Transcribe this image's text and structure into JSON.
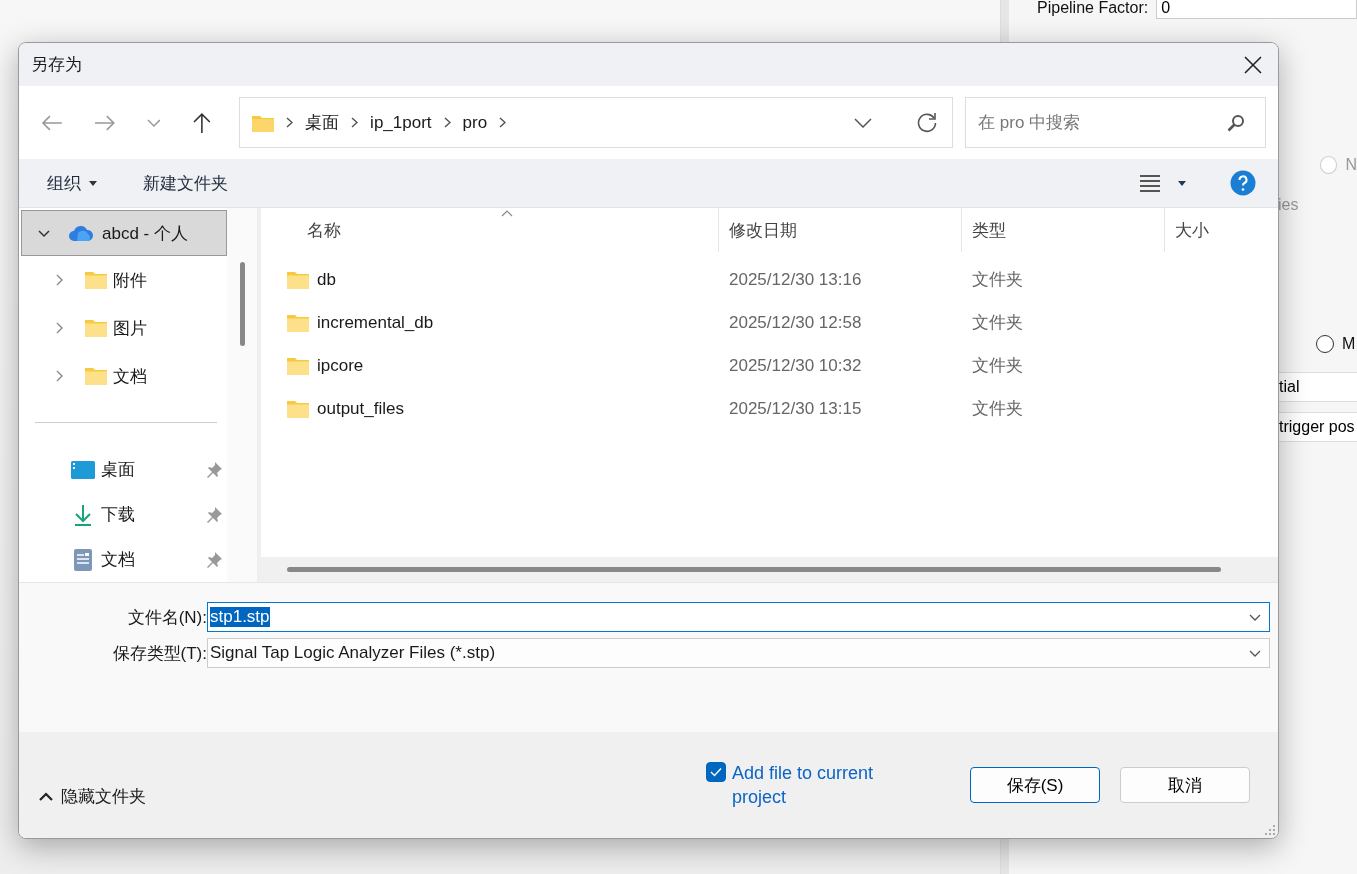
{
  "background_window": {
    "pipeline_label": "Pipeline Factor:",
    "pipeline_value": "0",
    "radios": [
      {
        "label": "N",
        "selected": false
      },
      {
        "label": "M",
        "selected": false
      }
    ],
    "fragments": [
      "ies",
      "tial",
      "trigger pos"
    ]
  },
  "dialog": {
    "title": "另存为",
    "breadcrumb": [
      "桌面",
      "ip_1port",
      "pro"
    ],
    "search": {
      "placeholder": "在 pro 中搜索"
    },
    "toolbar": {
      "organize": "组织",
      "new_folder": "新建文件夹"
    },
    "sidebar": {
      "root": {
        "label": "abcd - 个人",
        "expanded": true,
        "selected": true,
        "children": [
          {
            "label": "附件",
            "expanded": false
          },
          {
            "label": "图片",
            "expanded": false
          },
          {
            "label": "文档",
            "expanded": false
          }
        ]
      },
      "quick_access": [
        {
          "label": "桌面",
          "kind": "desktop",
          "pinned": true
        },
        {
          "label": "下载",
          "kind": "download",
          "pinned": true
        },
        {
          "label": "文档",
          "kind": "document",
          "pinned": true
        }
      ]
    },
    "columns": [
      "名称",
      "修改日期",
      "类型",
      "大小"
    ],
    "rows": [
      {
        "name": "db",
        "modified": "2025/12/30 13:16",
        "type": "文件夹"
      },
      {
        "name": "incremental_db",
        "modified": "2025/12/30 12:58",
        "type": "文件夹"
      },
      {
        "name": "ipcore",
        "modified": "2025/12/30 10:32",
        "type": "文件夹"
      },
      {
        "name": "output_files",
        "modified": "2025/12/30 13:15",
        "type": "文件夹"
      }
    ],
    "filename": {
      "label": "文件名(N):",
      "value": "stp1.stp"
    },
    "filetype": {
      "label": "保存类型(T):",
      "value": "Signal Tap Logic Analyzer Files (*.stp)"
    },
    "add_to_project": {
      "label": "Add file to current project",
      "checked": true
    },
    "hide_folders": "隐藏文件夹",
    "buttons": [
      {
        "label": "保存(S)",
        "kind": "primary"
      },
      {
        "label": "取消",
        "kind": "secondary"
      }
    ]
  }
}
